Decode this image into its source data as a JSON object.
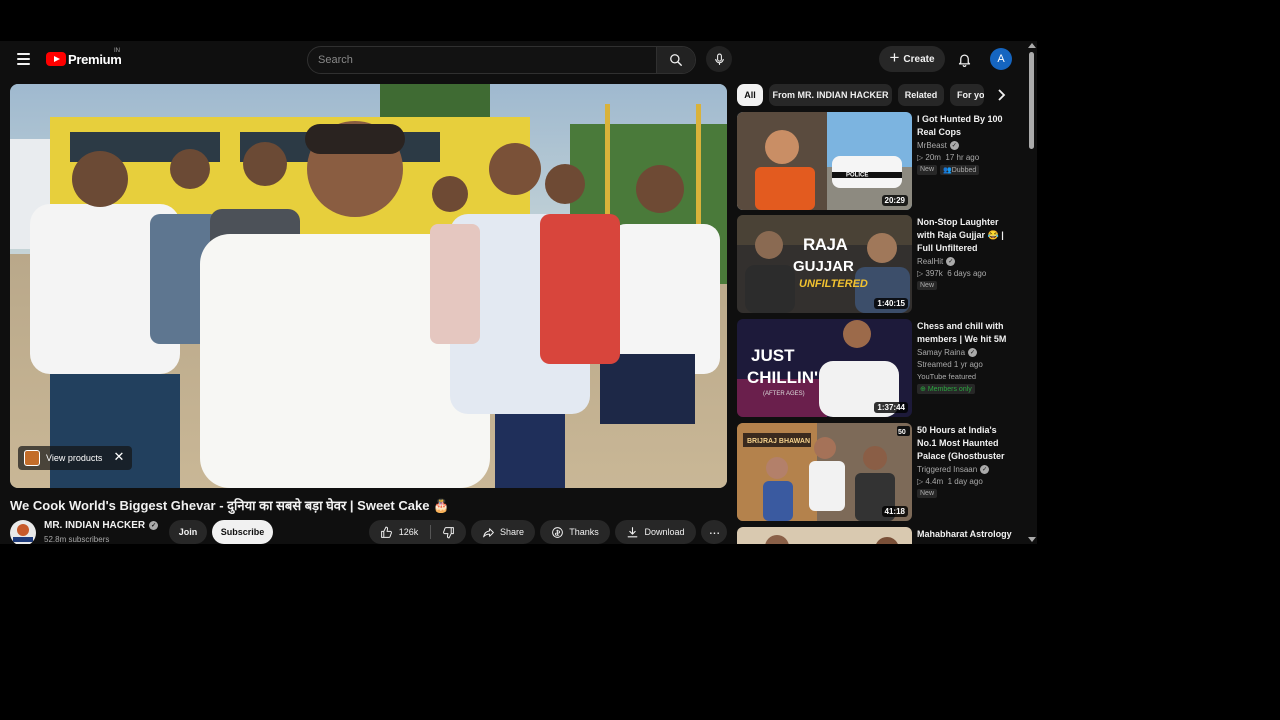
{
  "header": {
    "logo_text": "Premium",
    "logo_country": "IN",
    "search_placeholder": "Search",
    "create_label": "Create",
    "avatar_letter": "A"
  },
  "player": {
    "view_products_label": "View products"
  },
  "video": {
    "title": "We Cook World's Biggest Ghevar - दुनिया का सबसे बड़ा घेवर | Sweet Cake 🎂",
    "channel_name": "MR. INDIAN HACKER",
    "channel_avatar_text": "MR INDIAN HACKER",
    "subscribers": "52.8m subscribers",
    "join_label": "Join",
    "subscribe_label": "Subscribe",
    "like_count": "126k",
    "share_label": "Share",
    "thanks_label": "Thanks",
    "download_label": "Download"
  },
  "chips": [
    "All",
    "From MR. INDIAN HACKER",
    "Related",
    "For you"
  ],
  "recommendations": [
    {
      "title": "I Got Hunted By 100 Real Cops",
      "channel": "MrBeast",
      "verified": true,
      "views": "20m",
      "age": "17 hr ago",
      "duration": "20:29",
      "badges": [
        "New",
        "Dubbed"
      ],
      "thumb_text": "POLICE"
    },
    {
      "title": "Non-Stop Laughter with Raja Gujjar 😂 | Full Unfiltered Conversatio…",
      "channel": "RealHit",
      "verified": true,
      "views": "397k",
      "age": "6 days ago",
      "duration": "1:40:15",
      "badges": [
        "New"
      ],
      "thumb_text": "RAJA GUJJAR",
      "thumb_subtext": "UNFILTERED"
    },
    {
      "title": "Chess and chill with members | We hit 5M",
      "channel": "Samay Raina",
      "verified": true,
      "meta": "Streamed 1 yr ago",
      "featured": "YouTube featured",
      "members_badge": "Members only",
      "duration": "1:37:44",
      "thumb_text": "JUST CHILLIN'",
      "thumb_subtext": "(AFTER AGES)"
    },
    {
      "title": "50 Hours at India's No.1 Most Haunted Palace (Ghostbuster Chaggan…",
      "channel": "Triggered Insaan",
      "verified": true,
      "views": "4.4m",
      "age": "1 day ago",
      "duration": "41:18",
      "badges": [
        "New"
      ],
      "thumb_text": "BRIJRAJ BHAWAN",
      "thumb_corner": "50"
    },
    {
      "title": "Mahabharat Astrology"
    }
  ]
}
